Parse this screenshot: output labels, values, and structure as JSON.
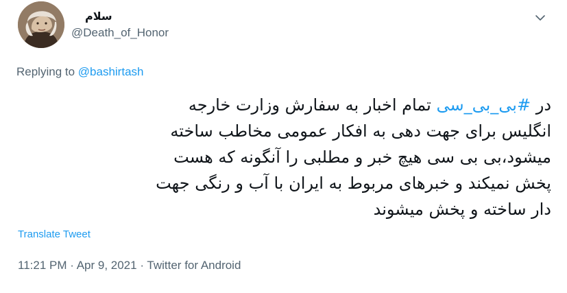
{
  "author": {
    "display_name": "سلام",
    "handle": "@Death_of_Honor",
    "avatar_icon": "profile-photo"
  },
  "reply_context": {
    "prefix": "Replying to ",
    "mention": "@bashirtash"
  },
  "tweet": {
    "line1_pre": "در ",
    "hashtag": "#بی_بی_سی",
    "line1_post": " تمام اخبار به سفارش وزارت خارجه",
    "line2": "انگلیس برای جهت دهی به افکار عمومی مخاطب ساخته",
    "line3": "میشود،بی بی سی هیچ خبر و مطلبی را آنگونه که هست",
    "line4": "پخش نمیکند و خبرهای مربوط به ایران با آب و رنگی جهت",
    "line5": "دار ساخته و پخش میشوند"
  },
  "translate_label": "Translate Tweet",
  "meta": {
    "time": "11:21 PM",
    "separator": " · ",
    "date": "Apr 9, 2021",
    "client": "Twitter for Android"
  },
  "colors": {
    "link": "#1d9bf0",
    "secondary_text": "#536471",
    "primary_text": "#0f1419"
  }
}
